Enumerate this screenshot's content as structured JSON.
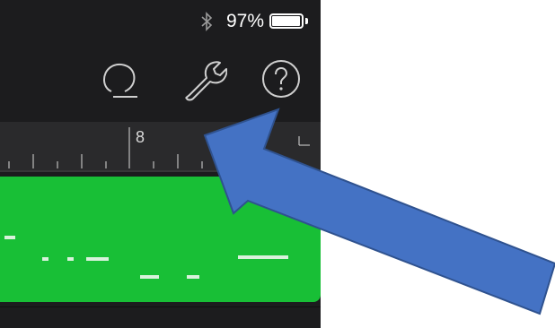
{
  "status_bar": {
    "bluetooth_icon": "bluetooth-icon",
    "battery_percent": "97%",
    "battery_level": 0.97
  },
  "toolbar": {
    "icons": [
      "loop-icon",
      "wrench-settings-icon",
      "help-icon"
    ]
  },
  "ruler": {
    "bar_label": "8"
  },
  "colors": {
    "background": "#1c1c1e",
    "region": "#18bf36",
    "note": "#d9f2dc",
    "arrow_fill": "#4472c4",
    "arrow_stroke": "#2f528f"
  }
}
